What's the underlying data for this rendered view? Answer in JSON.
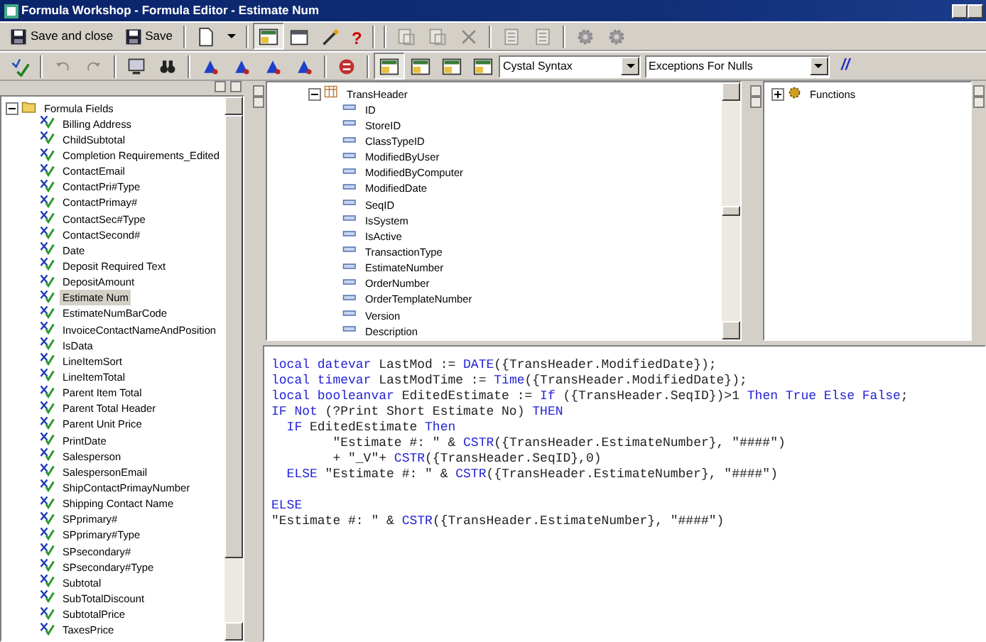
{
  "window": {
    "title": "Formula Workshop - Formula Editor - Estimate Num"
  },
  "toolbar_1": [
    {
      "kind": "button",
      "label": "Save and close"
    },
    {
      "kind": "button",
      "label": "Save"
    },
    {
      "kind": "separator"
    },
    {
      "kind": "icon",
      "disabled": false,
      "pressed": false
    },
    {
      "kind": "icon",
      "disabled": false,
      "pressed": false
    },
    {
      "kind": "separator"
    },
    {
      "kind": "icon",
      "disabled": false,
      "pressed": true
    },
    {
      "kind": "icon",
      "disabled": false,
      "pressed": false
    },
    {
      "kind": "icon",
      "disabled": false,
      "pressed": false
    },
    {
      "kind": "help",
      "label": "?"
    },
    {
      "kind": "separator"
    },
    {
      "kind": "separator"
    },
    {
      "kind": "icon",
      "disabled": true,
      "pressed": false
    },
    {
      "kind": "icon",
      "disabled": true,
      "pressed": false
    },
    {
      "kind": "icon",
      "disabled": true,
      "pressed": false
    },
    {
      "kind": "separator"
    },
    {
      "kind": "icon",
      "disabled": true,
      "pressed": false
    },
    {
      "kind": "icon",
      "disabled": true,
      "pressed": false
    },
    {
      "kind": "separator"
    },
    {
      "kind": "icon",
      "disabled": true,
      "pressed": false
    },
    {
      "kind": "icon",
      "disabled": true,
      "pressed": false
    }
  ],
  "toolbar_2": [
    {
      "kind": "icon",
      "disabled": false,
      "pressed": false
    },
    {
      "kind": "separator"
    },
    {
      "kind": "icon",
      "disabled": true,
      "pressed": false
    },
    {
      "kind": "icon",
      "disabled": true,
      "pressed": false
    },
    {
      "kind": "separator"
    },
    {
      "kind": "icon",
      "disabled": false,
      "pressed": false
    },
    {
      "kind": "icon",
      "disabled": false,
      "pressed": false
    },
    {
      "kind": "separator"
    },
    {
      "kind": "icon",
      "disabled": false,
      "pressed": false
    },
    {
      "kind": "icon",
      "disabled": false,
      "pressed": false
    },
    {
      "kind": "icon",
      "disabled": false,
      "pressed": false
    },
    {
      "kind": "icon",
      "disabled": false,
      "pressed": false
    },
    {
      "kind": "separator"
    },
    {
      "kind": "icon",
      "disabled": false,
      "pressed": false
    },
    {
      "kind": "separator"
    },
    {
      "kind": "icon",
      "disabled": false,
      "pressed": true
    },
    {
      "kind": "icon",
      "disabled": false,
      "pressed": false
    },
    {
      "kind": "icon",
      "disabled": false,
      "pressed": false
    },
    {
      "kind": "icon",
      "disabled": false,
      "pressed": false
    },
    {
      "kind": "select",
      "value": "Cystal Syntax"
    },
    {
      "kind": "select",
      "value": "Exceptions For Nulls"
    },
    {
      "kind": "text",
      "label": "//"
    }
  ],
  "formula_tree": {
    "label": "Formula Fields",
    "kind": "folder",
    "expanded": true,
    "children": [
      {
        "label": "Billing Address",
        "kind": "formula",
        "selected": false
      },
      {
        "label": "ChildSubtotal",
        "kind": "formula",
        "selected": false
      },
      {
        "label": "Completion Requirements_Edited",
        "kind": "formula",
        "selected": false
      },
      {
        "label": "ContactEmail",
        "kind": "formula",
        "selected": false
      },
      {
        "label": "ContactPri#Type",
        "kind": "formula",
        "selected": false
      },
      {
        "label": "ContactPrimay#",
        "kind": "formula",
        "selected": false
      },
      {
        "label": "ContactSec#Type",
        "kind": "formula",
        "selected": false
      },
      {
        "label": "ContactSecond#",
        "kind": "formula",
        "selected": false
      },
      {
        "label": "Date",
        "kind": "formula",
        "selected": false
      },
      {
        "label": "Deposit Required Text",
        "kind": "formula",
        "selected": false
      },
      {
        "label": "DepositAmount",
        "kind": "formula",
        "selected": false
      },
      {
        "label": "Estimate Num",
        "kind": "formula",
        "selected": true
      },
      {
        "label": "EstimateNumBarCode",
        "kind": "formula",
        "selected": false
      },
      {
        "label": "InvoiceContactNameAndPosition",
        "kind": "formula",
        "selected": false
      },
      {
        "label": "IsData",
        "kind": "formula",
        "selected": false
      },
      {
        "label": "LineItemSort",
        "kind": "formula",
        "selected": false
      },
      {
        "label": "LineItemTotal",
        "kind": "formula",
        "selected": false
      },
      {
        "label": "Parent Item Total",
        "kind": "formula",
        "selected": false
      },
      {
        "label": "Parent Total Header",
        "kind": "formula",
        "selected": false
      },
      {
        "label": "Parent Unit Price",
        "kind": "formula",
        "selected": false
      },
      {
        "label": "PrintDate",
        "kind": "formula",
        "selected": false
      },
      {
        "label": "Salesperson",
        "kind": "formula",
        "selected": false
      },
      {
        "label": "SalespersonEmail",
        "kind": "formula",
        "selected": false
      },
      {
        "label": "ShipContactPrimayNumber",
        "kind": "formula",
        "selected": false
      },
      {
        "label": "Shipping Contact Name",
        "kind": "formula",
        "selected": false
      },
      {
        "label": "SPprimary#",
        "kind": "formula",
        "selected": false
      },
      {
        "label": "SPprimary#Type",
        "kind": "formula",
        "selected": false
      },
      {
        "label": "SPsecondary#",
        "kind": "formula",
        "selected": false
      },
      {
        "label": "SPsecondary#Type",
        "kind": "formula",
        "selected": false
      },
      {
        "label": "Subtotal",
        "kind": "formula",
        "selected": false
      },
      {
        "label": "SubTotalDiscount",
        "kind": "formula",
        "selected": false
      },
      {
        "label": "SubtotalPrice",
        "kind": "formula",
        "selected": false
      },
      {
        "label": "TaxesPrice",
        "kind": "formula",
        "selected": false
      }
    ]
  },
  "field_tree": {
    "label": "TransHeader",
    "kind": "table",
    "expanded": true,
    "children": [
      {
        "label": "ID",
        "kind": "field"
      },
      {
        "label": "StoreID",
        "kind": "field"
      },
      {
        "label": "ClassTypeID",
        "kind": "field"
      },
      {
        "label": "ModifiedByUser",
        "kind": "field"
      },
      {
        "label": "ModifiedByComputer",
        "kind": "field"
      },
      {
        "label": "ModifiedDate",
        "kind": "field"
      },
      {
        "label": "SeqID",
        "kind": "field"
      },
      {
        "label": "IsSystem",
        "kind": "field"
      },
      {
        "label": "IsActive",
        "kind": "field"
      },
      {
        "label": "TransactionType",
        "kind": "field"
      },
      {
        "label": "EstimateNumber",
        "kind": "field"
      },
      {
        "label": "OrderNumber",
        "kind": "field"
      },
      {
        "label": "OrderTemplateNumber",
        "kind": "field"
      },
      {
        "label": "Version",
        "kind": "field"
      },
      {
        "label": "Description",
        "kind": "field"
      }
    ]
  },
  "function_tree": {
    "label": "Functions",
    "kind": "functions",
    "expanded": false
  },
  "editor": {
    "lines": [
      {
        "kind": "code",
        "segments": [
          {
            "kind": "keyword",
            "text": "local datevar"
          },
          {
            "kind": "plain",
            "text": " LastMod := "
          },
          {
            "kind": "keyword",
            "text": "DATE"
          },
          {
            "kind": "plain",
            "text": "({TransHeader.ModifiedDate});"
          }
        ]
      },
      {
        "kind": "code",
        "segments": [
          {
            "kind": "keyword",
            "text": "local timevar"
          },
          {
            "kind": "plain",
            "text": " LastModTime := "
          },
          {
            "kind": "keyword",
            "text": "Time"
          },
          {
            "kind": "plain",
            "text": "({TransHeader.ModifiedDate});"
          }
        ]
      },
      {
        "kind": "code",
        "segments": [
          {
            "kind": "keyword",
            "text": "local booleanvar"
          },
          {
            "kind": "plain",
            "text": " EditedEstimate := "
          },
          {
            "kind": "keyword",
            "text": "If"
          },
          {
            "kind": "plain",
            "text": " ({TransHeader.SeqID})>1 "
          },
          {
            "kind": "keyword",
            "text": "Then True Else False"
          },
          {
            "kind": "plain",
            "text": ";"
          }
        ]
      },
      {
        "kind": "code",
        "segments": [
          {
            "kind": "keyword",
            "text": "IF Not"
          },
          {
            "kind": "plain",
            "text": " (?Print Short Estimate No) "
          },
          {
            "kind": "keyword",
            "text": "THEN"
          }
        ]
      },
      {
        "kind": "code",
        "segments": [
          {
            "kind": "keyword",
            "text": "  IF"
          },
          {
            "kind": "plain",
            "text": " EditedEstimate "
          },
          {
            "kind": "keyword",
            "text": "Then"
          }
        ]
      },
      {
        "kind": "code",
        "segments": [
          {
            "kind": "plain",
            "text": "        \"Estimate #: \" & "
          },
          {
            "kind": "keyword",
            "text": "CSTR"
          },
          {
            "kind": "plain",
            "text": "({TransHeader.EstimateNumber}, \"####\")"
          }
        ]
      },
      {
        "kind": "code",
        "segments": [
          {
            "kind": "plain",
            "text": "        + \"_V\"+ "
          },
          {
            "kind": "keyword",
            "text": "CSTR"
          },
          {
            "kind": "plain",
            "text": "({TransHeader.SeqID},0)"
          }
        ]
      },
      {
        "kind": "code",
        "segments": [
          {
            "kind": "keyword",
            "text": "  ELSE"
          },
          {
            "kind": "plain",
            "text": " \"Estimate #: \" & "
          },
          {
            "kind": "keyword",
            "text": "CSTR"
          },
          {
            "kind": "plain",
            "text": "({TransHeader.EstimateNumber}, \"####\")"
          }
        ]
      },
      {
        "kind": "blank"
      },
      {
        "kind": "code",
        "segments": [
          {
            "kind": "keyword",
            "text": "ELSE"
          }
        ]
      },
      {
        "kind": "code",
        "segments": [
          {
            "kind": "plain",
            "text": "\"Estimate #: \" & "
          },
          {
            "kind": "keyword",
            "text": "CSTR"
          },
          {
            "kind": "plain",
            "text": "({TransHeader.EstimateNumber}, \"####\")"
          }
        ]
      }
    ]
  }
}
